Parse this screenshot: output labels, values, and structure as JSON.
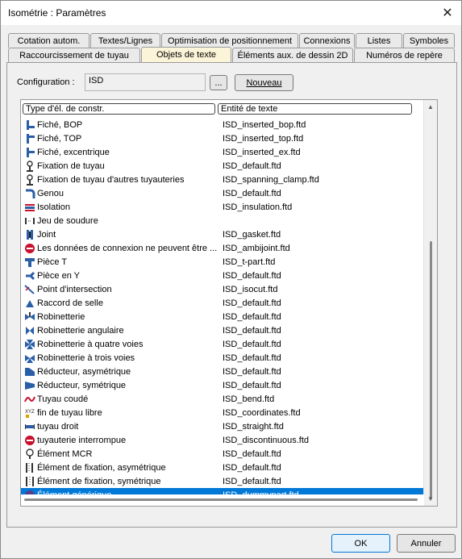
{
  "window": {
    "title": "Isométrie : Paramètres",
    "close_label": "✕"
  },
  "tabs_row1": [
    {
      "label": "Cotation autom."
    },
    {
      "label": "Textes/Lignes"
    },
    {
      "label": "Optimisation de positionnement"
    },
    {
      "label": "Connexions"
    },
    {
      "label": "Listes"
    },
    {
      "label": "Symboles"
    }
  ],
  "tabs_row2": [
    {
      "label": "Raccourcissement de tuyau"
    },
    {
      "label": "Objets de texte",
      "active": true
    },
    {
      "label": "Éléments aux. de dessin 2D"
    },
    {
      "label": "Numéros de repère"
    }
  ],
  "config": {
    "label": "Configuration :",
    "value": "ISD",
    "browse_label": "...",
    "new_label": "Nouveau"
  },
  "table": {
    "headers": [
      "Type d'él. de constr.",
      "Entité de texte"
    ],
    "rows": [
      {
        "type": "Fiché, BOP",
        "entity": "ISD_inserted_bop.ftd",
        "icon": "pipe-bop-icon"
      },
      {
        "type": "Fiché, TOP",
        "entity": "ISD_inserted_top.ftd",
        "icon": "pipe-top-icon"
      },
      {
        "type": "Fiché, excentrique",
        "entity": "ISD_inserted_ex.ftd",
        "icon": "pipe-eccentric-icon"
      },
      {
        "type": "Fixation de tuyau",
        "entity": "ISD_default.ftd",
        "icon": "pipe-support-icon"
      },
      {
        "type": "Fixation de tuyau d'autres tuyauteries",
        "entity": "ISD_spanning_clamp.ftd",
        "icon": "pipe-support-icon"
      },
      {
        "type": "Genou",
        "entity": "ISD_default.ftd",
        "icon": "elbow-icon"
      },
      {
        "type": "Isolation",
        "entity": "ISD_insulation.ftd",
        "icon": "insulation-icon"
      },
      {
        "type": "Jeu de soudure",
        "entity": "",
        "icon": "weld-gap-icon"
      },
      {
        "type": "Joint",
        "entity": "ISD_gasket.ftd",
        "icon": "gasket-icon"
      },
      {
        "type": "Les données de connexion ne peuvent être ...",
        "entity": "ISD_ambijoint.ftd",
        "icon": "no-entry-icon"
      },
      {
        "type": "Pièce T",
        "entity": "ISD_t-part.ftd",
        "icon": "tee-icon"
      },
      {
        "type": "Pièce en Y",
        "entity": "ISD_default.ftd",
        "icon": "wye-icon"
      },
      {
        "type": "Point d'intersection",
        "entity": "ISD_isocut.ftd",
        "icon": "intersection-icon"
      },
      {
        "type": "Raccord de selle",
        "entity": "ISD_default.ftd",
        "icon": "saddle-icon"
      },
      {
        "type": "Robinetterie",
        "entity": "ISD_default.ftd",
        "icon": "valve-icon"
      },
      {
        "type": "Robinetterie angulaire",
        "entity": "ISD_default.ftd",
        "icon": "angle-valve-icon"
      },
      {
        "type": "Robinetterie à quatre voies",
        "entity": "ISD_default.ftd",
        "icon": "four-way-valve-icon"
      },
      {
        "type": "Robinetterie à trois voies",
        "entity": "ISD_default.ftd",
        "icon": "three-way-valve-icon"
      },
      {
        "type": "Réducteur, asymétrique",
        "entity": "ISD_default.ftd",
        "icon": "reducer-asym-icon"
      },
      {
        "type": "Réducteur, symétrique",
        "entity": "ISD_default.ftd",
        "icon": "reducer-sym-icon"
      },
      {
        "type": "Tuyau coudé",
        "entity": "ISD_bend.ftd",
        "icon": "bend-icon"
      },
      {
        "type": "fin de tuyau libre",
        "entity": "ISD_coordinates.ftd",
        "icon": "xyz-icon"
      },
      {
        "type": "tuyau droit",
        "entity": "ISD_straight.ftd",
        "icon": "straight-pipe-icon"
      },
      {
        "type": "tuyauterie interrompue",
        "entity": "ISD_discontinuous.ftd",
        "icon": "no-entry-icon"
      },
      {
        "type": "Élément MCR",
        "entity": "ISD_default.ftd",
        "icon": "mcr-icon"
      },
      {
        "type": "Élément de fixation, asymétrique",
        "entity": "ISD_default.ftd",
        "icon": "fixing-asym-icon"
      },
      {
        "type": "Élément de fixation, symétrique",
        "entity": "ISD_default.ftd",
        "icon": "fixing-sym-icon"
      },
      {
        "type": "Élément générique",
        "entity": "ISD_dummypart.ftd",
        "icon": "generic-element-icon",
        "selected": true
      }
    ]
  },
  "buttons": {
    "ok": "OK",
    "cancel": "Annuler"
  },
  "colors": {
    "selection": "#0078d7",
    "active_tab": "#fcf4d9",
    "pipe_blue": "#2a5fa8",
    "red": "#c8102e"
  }
}
